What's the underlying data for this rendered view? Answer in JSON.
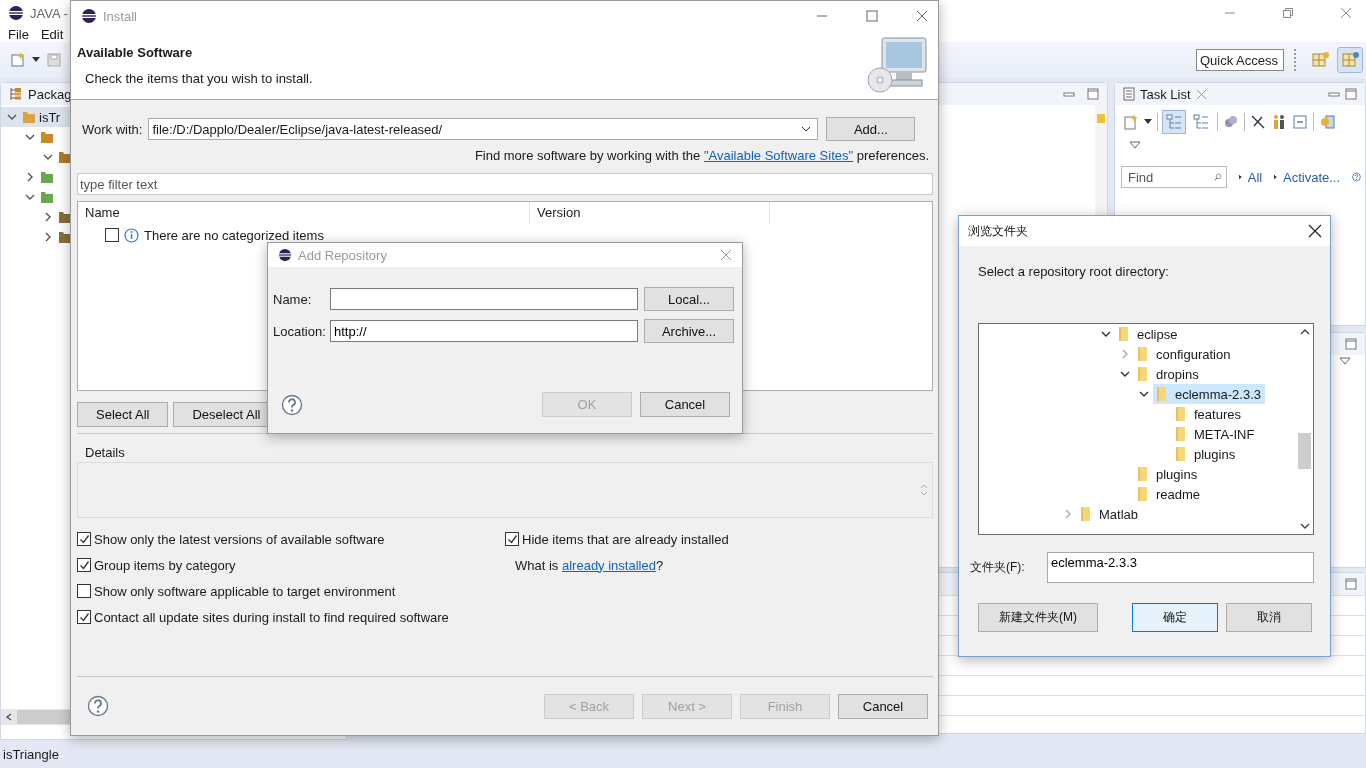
{
  "eclipse": {
    "title": "JAVA -",
    "menu": [
      "File",
      "Edit"
    ],
    "quick_access": {
      "placeholder": "Quick Access"
    },
    "perspectives": [
      {
        "selected": false
      },
      {
        "selected": true
      }
    ],
    "package_explorer": {
      "tab": "Packag",
      "tree": [
        {
          "label": "isTr",
          "kind": "project",
          "selected": true,
          "expanded": true,
          "children": [
            {
              "kind": "source",
              "selected": false,
              "expanded": true,
              "children": [
                {
                  "kind": "package",
                  "selected": false,
                  "expanded": true
                }
              ]
            },
            {
              "kind": "library",
              "selected": false,
              "expanded": false
            },
            {
              "kind": "library",
              "selected": false,
              "expanded": true,
              "children": [
                {
                  "kind": "jar",
                  "selected": false,
                  "expanded": false
                },
                {
                  "kind": "jar",
                  "selected": false,
                  "expanded": false
                }
              ]
            }
          ]
        }
      ]
    },
    "task_list": {
      "title": "Task List",
      "view_toggles": [
        {
          "selected": true
        },
        {
          "selected": false
        }
      ],
      "find": {
        "placeholder": "Find"
      },
      "links": [
        "All",
        "Activate..."
      ]
    },
    "status_bar": "isTriangle"
  },
  "install_dialog": {
    "title": "Install",
    "active": false,
    "heading": "Available Software",
    "description": "Check the items that you wish to install.",
    "work_with": {
      "label": "Work with:",
      "value": "file:/D:/Dapplo/Dealer/Eclipse/java-latest-released/"
    },
    "add_button": "Add...",
    "sites_note": {
      "before": "Find more software by working with the ",
      "link": "\"Available Software Sites\"",
      "after": " preferences."
    },
    "filter": {
      "placeholder": "type filter text"
    },
    "columns": [
      "Name",
      "Version"
    ],
    "rows": [
      {
        "checked": false,
        "text": "There are no categorized items"
      }
    ],
    "select_buttons": [
      "Select All",
      "Deselect All"
    ],
    "details_label": "Details",
    "options": [
      {
        "label": "Show only the latest versions of available software",
        "checked": true
      },
      {
        "label": "Group items by category",
        "checked": true
      },
      {
        "label": "Show only software applicable to target environment",
        "checked": false
      },
      {
        "label": "Contact all update sites during install to find required software",
        "checked": true
      }
    ],
    "side_options": [
      {
        "label": "Hide items that are already installed",
        "checked": true
      }
    ],
    "installed_note": {
      "before": "What is ",
      "link": "already installed",
      "after": "?"
    },
    "buttons": [
      {
        "label": "< Back",
        "disabled": true
      },
      {
        "label": "Next >",
        "disabled": true
      },
      {
        "label": "Finish",
        "disabled": true
      },
      {
        "label": "Cancel",
        "disabled": false
      }
    ]
  },
  "add_repository_dialog": {
    "title": "Add Repository",
    "active": false,
    "fields": [
      {
        "label": "Name:",
        "button": "Local..."
      },
      {
        "label": "Location:",
        "value": "http://",
        "button": "Archive..."
      }
    ],
    "buttons": [
      {
        "label": "OK",
        "disabled": true
      },
      {
        "label": "Cancel",
        "disabled": false
      }
    ]
  },
  "browse_dialog": {
    "title": "浏览文件夹",
    "active": true,
    "prompt": "Select a repository root directory:",
    "tree": [
      {
        "children": [
          {
            "children": [
              {
                "label": "eclipse",
                "expanded": true,
                "selected": false,
                "children": [
                  {
                    "label": "configuration",
                    "expanded": false,
                    "selected": false
                  },
                  {
                    "label": "dropins",
                    "expanded": true,
                    "selected": false,
                    "children": [
                      {
                        "label": "eclemma-2.3.3",
                        "expanded": true,
                        "selected": true,
                        "children": [
                          {
                            "label": "features",
                            "selected": false
                          },
                          {
                            "label": "META-INF",
                            "selected": false
                          },
                          {
                            "label": "plugins",
                            "selected": false
                          }
                        ]
                      }
                    ]
                  },
                  {
                    "label": "plugins",
                    "selected": false
                  },
                  {
                    "label": "readme",
                    "selected": false
                  }
                ]
              }
            ]
          }
        ]
      },
      {
        "label": "Matlab",
        "expanded": false,
        "selected": false
      }
    ],
    "folder": {
      "label": "文件夹(F):",
      "value": "eclemma-2.3.3"
    },
    "buttons": [
      {
        "label": "新建文件夹(M)",
        "default": false
      },
      {
        "label": "确定",
        "default": true
      },
      {
        "label": "取消",
        "default": false
      }
    ]
  }
}
